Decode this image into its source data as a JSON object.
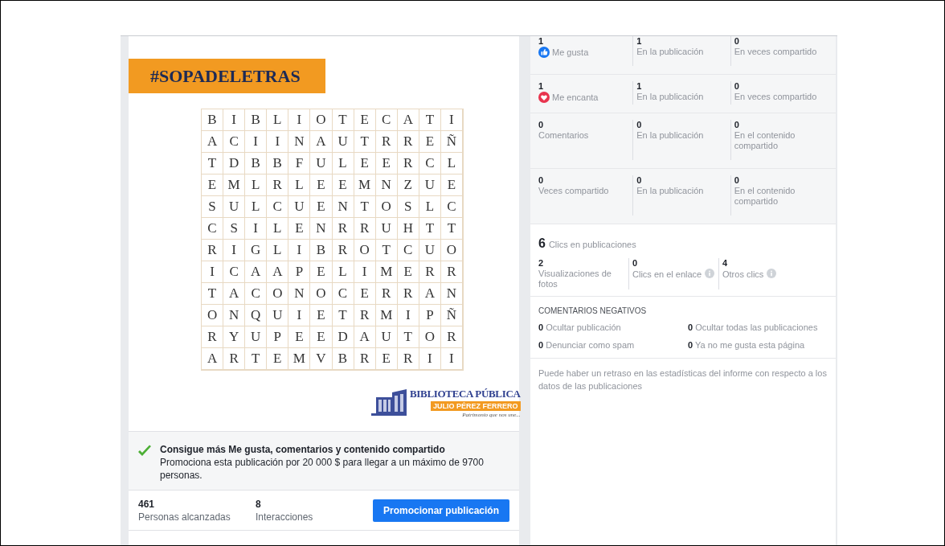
{
  "post": {
    "hashtag": "#SOPADELETRAS",
    "grid": [
      [
        "B",
        "I",
        "B",
        "L",
        "I",
        "O",
        "T",
        "E",
        "C",
        "A",
        "T",
        "I"
      ],
      [
        "A",
        "C",
        "I",
        "I",
        "N",
        "A",
        "U",
        "T",
        "R",
        "R",
        "E",
        "Ñ"
      ],
      [
        "T",
        "D",
        "B",
        "B",
        "F",
        "U",
        "L",
        "E",
        "E",
        "R",
        "C",
        "L"
      ],
      [
        "E",
        "M",
        "L",
        "R",
        "L",
        "E",
        "E",
        "M",
        "N",
        "Z",
        "U",
        "E"
      ],
      [
        "S",
        "U",
        "L",
        "C",
        "U",
        "E",
        "N",
        "T",
        "O",
        "S",
        "L",
        "C"
      ],
      [
        "C",
        "S",
        "I",
        "L",
        "E",
        "N",
        "R",
        "R",
        "U",
        "H",
        "T",
        "T"
      ],
      [
        "R",
        "I",
        "G",
        "L",
        "I",
        "B",
        "R",
        "O",
        "T",
        "C",
        "U",
        "O"
      ],
      [
        "I",
        "C",
        "A",
        "A",
        "P",
        "E",
        "L",
        "I",
        "M",
        "E",
        "R",
        "R"
      ],
      [
        "T",
        "A",
        "C",
        "O",
        "N",
        "O",
        "C",
        "E",
        "R",
        "R",
        "A",
        "N"
      ],
      [
        "O",
        "N",
        "Q",
        "U",
        "I",
        "E",
        "T",
        "R",
        "M",
        "I",
        "P",
        "Ñ"
      ],
      [
        "R",
        "Y",
        "U",
        "P",
        "E",
        "E",
        "D",
        "A",
        "U",
        "T",
        "O",
        "R"
      ],
      [
        "A",
        "R",
        "T",
        "E",
        "M",
        "V",
        "B",
        "R",
        "E",
        "R",
        "I",
        "I"
      ]
    ],
    "logo": {
      "name": "BIBLIOTECA PÚBLICA",
      "subtitle": "JULIO PÉREZ FERRERO",
      "tagline": "Patrimonio que nos une..."
    }
  },
  "promotion": {
    "title": "Consigue más Me gusta, comentarios y contenido compartido",
    "text": "Promociona esta publicación por 20 000 $ para llegar a un máximo de 9700 personas."
  },
  "summary": [
    {
      "value": "461",
      "label": "Personas alcanzadas"
    },
    {
      "value": "8",
      "label": "Interacciones"
    }
  ],
  "promote_button": "Promocionar publicación",
  "reactions": [
    {
      "kind": "like",
      "value": "1",
      "label": "Me gusta",
      "cells": [
        {
          "value": "1",
          "label": "En la publicación"
        },
        {
          "value": "0",
          "label": "En veces compartido"
        }
      ]
    },
    {
      "kind": "love",
      "value": "1",
      "label": "Me encanta",
      "cells": [
        {
          "value": "1",
          "label": "En la publicación"
        },
        {
          "value": "0",
          "label": "En veces compartido"
        }
      ]
    },
    {
      "kind": "plain",
      "value": "0",
      "label": "Comentarios",
      "cells": [
        {
          "value": "0",
          "label": "En la publicación"
        },
        {
          "value": "0",
          "label": "En el contenido compartido"
        }
      ]
    },
    {
      "kind": "plain",
      "value": "0",
      "label": "Veces compartido",
      "cells": [
        {
          "value": "0",
          "label": "En la publicación"
        },
        {
          "value": "0",
          "label": "En el contenido compartido"
        }
      ]
    }
  ],
  "clicks": {
    "total": "6",
    "label": "Clics en publicaciones",
    "items": [
      {
        "value": "2",
        "label": "Visualizaciones de fotos",
        "info": false
      },
      {
        "value": "0",
        "label": "Clics en el enlace",
        "info": true
      },
      {
        "value": "4",
        "label": "Otros clics",
        "info": true
      }
    ]
  },
  "negative": {
    "title": "COMENTARIOS NEGATIVOS",
    "items": [
      {
        "value": "0",
        "label": "Ocultar publicación"
      },
      {
        "value": "0",
        "label": "Ocultar todas las publicaciones"
      },
      {
        "value": "0",
        "label": "Denunciar como spam"
      },
      {
        "value": "0",
        "label": "Ya no me gusta esta página"
      }
    ]
  },
  "note": "Puede haber un retraso en las estadísticas del informe con respecto a los datos de las publicaciones"
}
